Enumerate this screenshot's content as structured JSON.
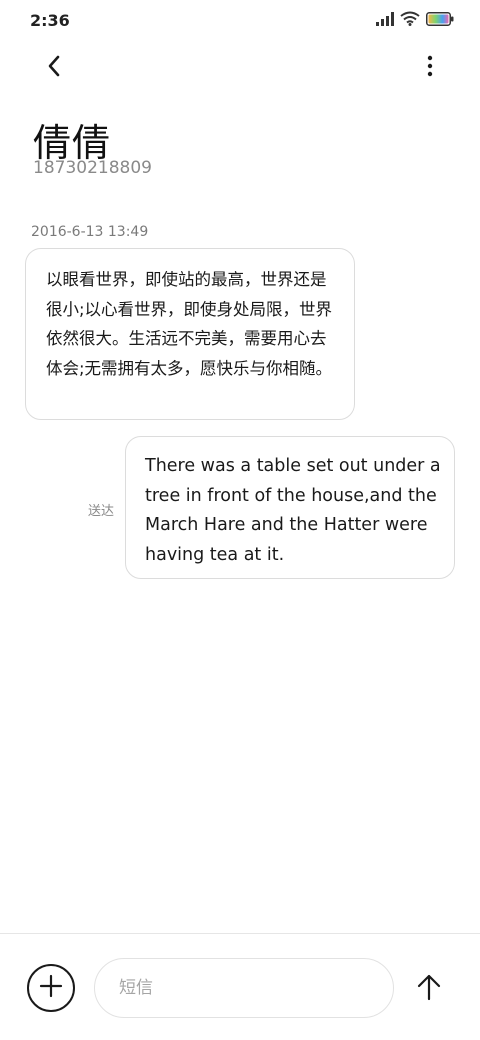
{
  "status_bar": {
    "time": "2:36",
    "icons": [
      "signal-icon",
      "wifi-icon",
      "battery-icon"
    ]
  },
  "header": {
    "back_icon": "chevron-left-icon",
    "more_icon": "more-vertical-icon",
    "contact_name": "倩倩",
    "contact_number": "18730218809"
  },
  "conversation": {
    "timestamp": "2016-6-13 13:49",
    "messages": [
      {
        "direction": "incoming",
        "text": "以眼看世界，即使站的最高，世界还是很小;以心看世界，即使身处局限，世界依然很大。生活远不完美，需要用心去体会;无需拥有太多，愿快乐与你相随。"
      },
      {
        "direction": "outgoing",
        "text": "There was a table set out under a tree in front of the house,and the March Hare and the Hatter were having tea at it.",
        "status": "送达"
      }
    ]
  },
  "composer": {
    "add_icon": "plus-circle-icon",
    "placeholder": "短信",
    "value": "",
    "send_icon": "arrow-up-icon"
  },
  "colors": {
    "background": "#ffffff",
    "bubble_border": "#dcdcdc",
    "secondary_text": "#8a8a8a",
    "battery_gradient": [
      "#f5b54a",
      "#7ed36f",
      "#4aa0f0",
      "#e96bb0"
    ]
  }
}
